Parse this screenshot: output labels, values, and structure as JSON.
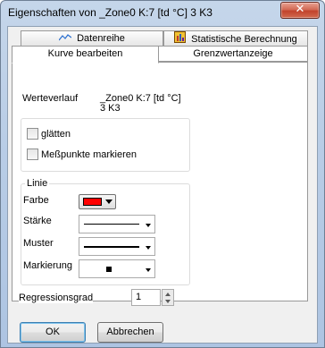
{
  "window": {
    "title": "Eigenschaften von _Zone0 K:7 [td °C] 3 K3",
    "close_glyph": "✕"
  },
  "tabs": {
    "row1": [
      {
        "label": "Datenreihe",
        "icon": "line-chart-icon"
      },
      {
        "label": "Statistische Berechnung",
        "icon": "statistics-icon"
      }
    ],
    "row2": [
      {
        "label": "Kurve bearbeiten",
        "active": true
      },
      {
        "label": "Grenzwertanzeige",
        "active": false
      }
    ]
  },
  "panel": {
    "werteverlauf_label": "Werteverlauf",
    "werteverlauf_value_line1": "_Zone0 K:7 [td °C]",
    "werteverlauf_value_line2": "3 K3",
    "smooth_label": "glätten",
    "smooth_checked": false,
    "mark_points_label": "Meßpunkte markieren",
    "mark_points_checked": false,
    "line_group": {
      "title": "Linie",
      "color_label": "Farbe",
      "color_value": "#ff0000",
      "width_label": "Stärke",
      "pattern_label": "Muster",
      "marker_label": "Markierung"
    },
    "regression_label": "Regressionsgrad",
    "regression_value": "1"
  },
  "buttons": {
    "ok": "OK",
    "cancel": "Abbrechen"
  }
}
